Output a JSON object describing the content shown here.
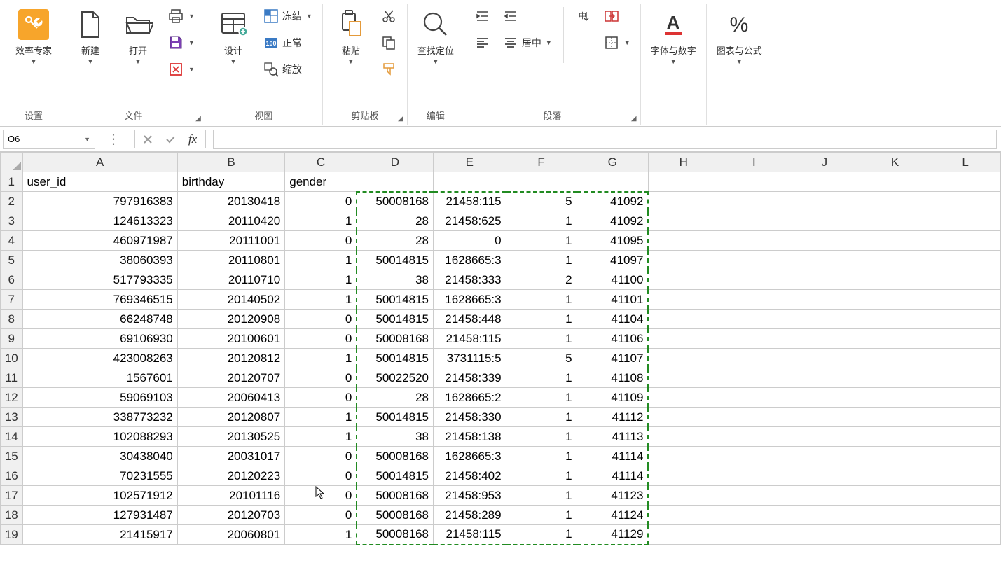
{
  "ribbon": {
    "settings_group": {
      "label": "设置",
      "expert": "效率专家"
    },
    "file_group": {
      "label": "文件",
      "new": "新建",
      "open": "打开"
    },
    "view_group": {
      "label": "视图",
      "design": "设计",
      "freeze": "冻结",
      "normal": "正常",
      "zoom": "缩放"
    },
    "clipboard_group": {
      "label": "剪贴板",
      "paste": "粘贴"
    },
    "edit_group": {
      "label": "编辑",
      "find": "查找定位"
    },
    "paragraph_group": {
      "label": "段落",
      "center": "居中"
    },
    "font_group": {
      "label": "字体与数字"
    },
    "chart_group": {
      "label": "图表与公式"
    }
  },
  "namebox": {
    "value": "O6"
  },
  "columns": [
    "A",
    "B",
    "C",
    "D",
    "E",
    "F",
    "G",
    "H",
    "I",
    "J",
    "K",
    "L"
  ],
  "headers": [
    "user_id",
    "birthday",
    "gender",
    "",
    "",
    "",
    "",
    "",
    "",
    "",
    "",
    ""
  ],
  "rows": [
    [
      "797916383",
      "20130418",
      "0",
      "50008168",
      "21458:115",
      "5",
      "41092",
      "",
      "",
      "",
      "",
      ""
    ],
    [
      "124613323",
      "20110420",
      "1",
      "28",
      "21458:625",
      "1",
      "41092",
      "",
      "",
      "",
      "",
      ""
    ],
    [
      "460971987",
      "20111001",
      "0",
      "28",
      "0",
      "1",
      "41095",
      "",
      "",
      "",
      "",
      ""
    ],
    [
      "38060393",
      "20110801",
      "1",
      "50014815",
      "1628665:3",
      "1",
      "41097",
      "",
      "",
      "",
      "",
      ""
    ],
    [
      "517793335",
      "20110710",
      "1",
      "38",
      "21458:333",
      "2",
      "41100",
      "",
      "",
      "",
      "",
      ""
    ],
    [
      "769346515",
      "20140502",
      "1",
      "50014815",
      "1628665:3",
      "1",
      "41101",
      "",
      "",
      "",
      "",
      ""
    ],
    [
      "66248748",
      "20120908",
      "0",
      "50014815",
      "21458:448",
      "1",
      "41104",
      "",
      "",
      "",
      "",
      ""
    ],
    [
      "69106930",
      "20100601",
      "0",
      "50008168",
      "21458:115",
      "1",
      "41106",
      "",
      "",
      "",
      "",
      ""
    ],
    [
      "423008263",
      "20120812",
      "1",
      "50014815",
      "3731115:5",
      "5",
      "41107",
      "",
      "",
      "",
      "",
      ""
    ],
    [
      "1567601",
      "20120707",
      "0",
      "50022520",
      "21458:339",
      "1",
      "41108",
      "",
      "",
      "",
      "",
      ""
    ],
    [
      "59069103",
      "20060413",
      "0",
      "28",
      "1628665:2",
      "1",
      "41109",
      "",
      "",
      "",
      "",
      ""
    ],
    [
      "338773232",
      "20120807",
      "1",
      "50014815",
      "21458:330",
      "1",
      "41112",
      "",
      "",
      "",
      "",
      ""
    ],
    [
      "102088293",
      "20130525",
      "1",
      "38",
      "21458:138",
      "1",
      "41113",
      "",
      "",
      "",
      "",
      ""
    ],
    [
      "30438040",
      "20031017",
      "0",
      "50008168",
      "1628665:3",
      "1",
      "41114",
      "",
      "",
      "",
      "",
      ""
    ],
    [
      "70231555",
      "20120223",
      "0",
      "50014815",
      "21458:402",
      "1",
      "41114",
      "",
      "",
      "",
      "",
      ""
    ],
    [
      "102571912",
      "20101116",
      "0",
      "50008168",
      "21458:953",
      "1",
      "41123",
      "",
      "",
      "",
      "",
      ""
    ],
    [
      "127931487",
      "20120703",
      "0",
      "50008168",
      "21458:289",
      "1",
      "41124",
      "",
      "",
      "",
      "",
      ""
    ],
    [
      "21415917",
      "20060801",
      "1",
      "50008168",
      "21458:115",
      "1",
      "41129",
      "",
      "",
      "",
      "",
      ""
    ]
  ]
}
